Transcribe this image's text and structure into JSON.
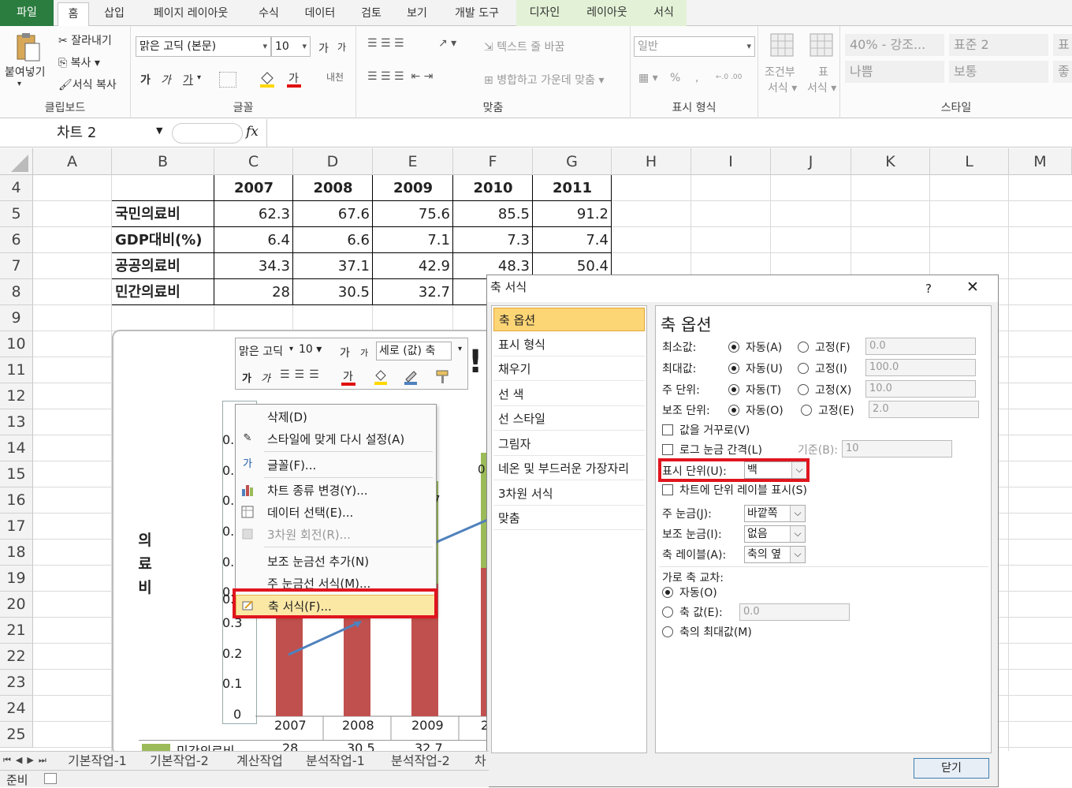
{
  "ribbon": {
    "tabs": [
      "파일",
      "홈",
      "삽입",
      "페이지 레이아웃",
      "수식",
      "데이터",
      "검토",
      "보기",
      "개발 도구",
      "디자인",
      "레이아웃",
      "서식"
    ],
    "clipboard": {
      "paste": "붙여넣기",
      "cut": "잘라내기",
      "copy": "복사",
      "format_painter": "서식 복사",
      "label": "클립보드"
    },
    "font": {
      "name": "맑은 고딕 (본문)",
      "size": "10",
      "label": "글꼴",
      "grow": "가",
      "shrink": "가",
      "bold": "가",
      "italic": "가",
      "underline": "가",
      "color_a": "가",
      "phonetic": "내천"
    },
    "align": {
      "wrap": "텍스트 줄 바꿈",
      "merge": "병합하고 가운데 맞춤",
      "label": "맞춤"
    },
    "number": {
      "format": "일반",
      "percent": "%",
      "comma": ",",
      "label": "표시 형식",
      "increase": "←.0 .00",
      "decrease": ".00 →.0"
    },
    "cond": {
      "cond_format": "조건부",
      "cond_format2": "서식",
      "table_format": "표",
      "table_format2": "서식"
    },
    "styles": {
      "s1": "40% - 강조...",
      "s2": "표준 2",
      "s3": "표",
      "s4": "나쁨",
      "s5": "보통",
      "s6": "좋",
      "label": "스타일"
    }
  },
  "formula": {
    "name_box": "차트 2",
    "fx": "fx"
  },
  "columns": [
    "A",
    "B",
    "C",
    "D",
    "E",
    "F",
    "G",
    "H",
    "I",
    "J",
    "K",
    "L",
    "M"
  ],
  "rows": [
    "4",
    "5",
    "6",
    "7",
    "8",
    "9",
    "10",
    "11",
    "12",
    "13",
    "14",
    "15",
    "16",
    "17",
    "18",
    "19",
    "20",
    "21",
    "22",
    "23",
    "24",
    "25"
  ],
  "table": {
    "years": [
      "2007",
      "2008",
      "2009",
      "2010",
      "2011"
    ],
    "rows": [
      {
        "label": "국민의료비",
        "values": [
          "62.3",
          "67.6",
          "75.6",
          "85.5",
          "91.2"
        ]
      },
      {
        "label": "GDP대비(%)",
        "values": [
          "6.4",
          "6.6",
          "7.1",
          "7.3",
          "7.4"
        ]
      },
      {
        "label": "공공의료비",
        "values": [
          "34.3",
          "37.1",
          "42.9",
          "48.3",
          "50.4"
        ]
      },
      {
        "label": "민간의료비",
        "values": [
          "28",
          "30.5",
          "32.7",
          "",
          ""
        ]
      }
    ]
  },
  "chart": {
    "ylabel": [
      "의",
      "료",
      "비"
    ],
    "ticks": [
      "0.3",
      "0.2",
      "0.1",
      "0"
    ],
    "partial_ticks": [
      "0.",
      "0.",
      "0.",
      "0.",
      "0.",
      "0.",
      "0."
    ],
    "x": [
      "2007",
      "2008",
      "2009"
    ],
    "x_partial": "2",
    "legend_label": "민간의료비",
    "legend_values": [
      "28",
      "30.5",
      "32.7"
    ],
    "fragment_7": "7",
    "fragment_0": "0.",
    "title_fragment": "!"
  },
  "mini_toolbar": {
    "font": "맑은 고딕",
    "size": "10",
    "element": "세로 (값) 축",
    "grow": "가",
    "shrink": "가",
    "bold": "가",
    "italic": "가",
    "color_a": "가"
  },
  "context_menu": {
    "items": [
      {
        "label": "삭제(D)",
        "disabled": false
      },
      {
        "label": "스타일에 맞게 다시 설정(A)",
        "disabled": false
      },
      {
        "label": "글꼴(F)...",
        "disabled": false
      },
      {
        "label": "차트 종류 변경(Y)...",
        "disabled": false
      },
      {
        "label": "데이터 선택(E)...",
        "disabled": false
      },
      {
        "label": "3차원 회전(R)...",
        "disabled": true
      },
      {
        "label": "보조 눈금선 추가(N)",
        "disabled": false
      },
      {
        "label": "주 눈금선 서식(M)...",
        "disabled": false
      },
      {
        "label": "축 서식(F)...",
        "disabled": false
      }
    ]
  },
  "dialog": {
    "title": "축 서식",
    "help": "?",
    "close": "✕",
    "nav": [
      "축 옵션",
      "표시 형식",
      "채우기",
      "선 색",
      "선 스타일",
      "그림자",
      "네온 및 부드러운 가장자리",
      "3차원 서식",
      "맞춤"
    ],
    "heading": "축 옵션",
    "rows": [
      {
        "label": "최소값:",
        "auto": "자동(A)",
        "fixed": "고정(F)",
        "value": "0.0"
      },
      {
        "label": "최대값:",
        "auto": "자동(U)",
        "fixed": "고정(I)",
        "value": "100.0"
      },
      {
        "label": "주 단위:",
        "auto": "자동(T)",
        "fixed": "고정(X)",
        "value": "10.0"
      },
      {
        "label": "보조 단위:",
        "auto": "자동(O)",
        "fixed": "고정(E)",
        "value": "2.0"
      }
    ],
    "reverse": "값을 거꾸로(V)",
    "log": "로그 눈금 간격(L)",
    "base_label": "기준(B):",
    "base_value": "10",
    "display_unit_label": "표시 단위(U):",
    "display_unit_value": "백",
    "show_unit_label": "차트에 단위 레이블 표시(S)",
    "major_tick_label": "주 눈금(J):",
    "major_tick_value": "바깥쪽",
    "minor_tick_label": "보조 눈금(I):",
    "minor_tick_value": "없음",
    "axis_label_label": "축 레이블(A):",
    "axis_label_value": "축의 옆",
    "cross_heading": "가로 축 교차:",
    "cross_auto": "자동(O)",
    "cross_value_label": "축 값(E):",
    "cross_value": "0.0",
    "cross_max": "축의 최대값(M)",
    "close_button": "닫기"
  },
  "sheets": [
    "기본작업-1",
    "기본작업-2",
    "계산작업",
    "분석작업-1",
    "분석작업-2",
    "차"
  ],
  "status": "준비"
}
